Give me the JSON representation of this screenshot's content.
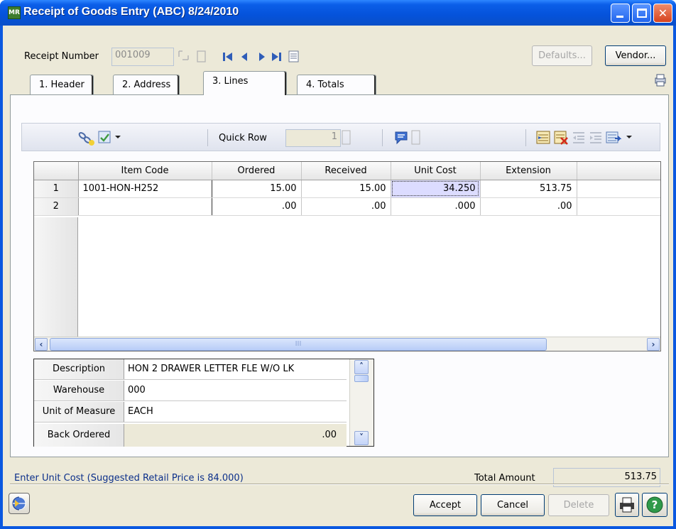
{
  "window": {
    "title": "Receipt of Goods Entry (ABC) 8/24/2010",
    "app_icon_text": "MR"
  },
  "header": {
    "receipt_number_label": "Receipt Number",
    "receipt_number_value": "001009",
    "defaults_label": "Defaults...",
    "vendor_label": "Vendor..."
  },
  "tabs": [
    {
      "label": "1. Header"
    },
    {
      "label": "2. Address"
    },
    {
      "label": "3. Lines"
    },
    {
      "label": "4. Totals"
    }
  ],
  "toolbar": {
    "quick_row_label": "Quick Row",
    "quick_row_value": "1"
  },
  "grid": {
    "columns": [
      "Item Code",
      "Ordered",
      "Received",
      "Unit Cost",
      "Extension"
    ],
    "rows": [
      {
        "num": "1",
        "item_code": "1001-HON-H252",
        "ordered": "15.00",
        "received": "15.00",
        "unit_cost": "34.250",
        "extension": "513.75"
      },
      {
        "num": "2",
        "item_code": "",
        "ordered": ".00",
        "received": ".00",
        "unit_cost": ".000",
        "extension": ".00"
      }
    ],
    "scroll_grip": "III"
  },
  "detail": [
    {
      "label": "Description",
      "value": "HON 2 DRAWER LETTER FLE W/O LK"
    },
    {
      "label": "Warehouse",
      "value": "000"
    },
    {
      "label": "Unit of Measure",
      "value": "EACH"
    },
    {
      "label": "Back Ordered",
      "value": ".00"
    }
  ],
  "status": {
    "message": "Enter Unit Cost (Suggested Retail Price is 84.000)",
    "total_amount_label": "Total Amount",
    "total_amount_value": "513.75"
  },
  "footer": {
    "accept_label": "Accept",
    "cancel_label": "Cancel",
    "delete_label": "Delete"
  },
  "colors": {
    "status_text": "#0b2f8a",
    "titlebar": "#0552da",
    "current_cell": "#dcdcff"
  }
}
